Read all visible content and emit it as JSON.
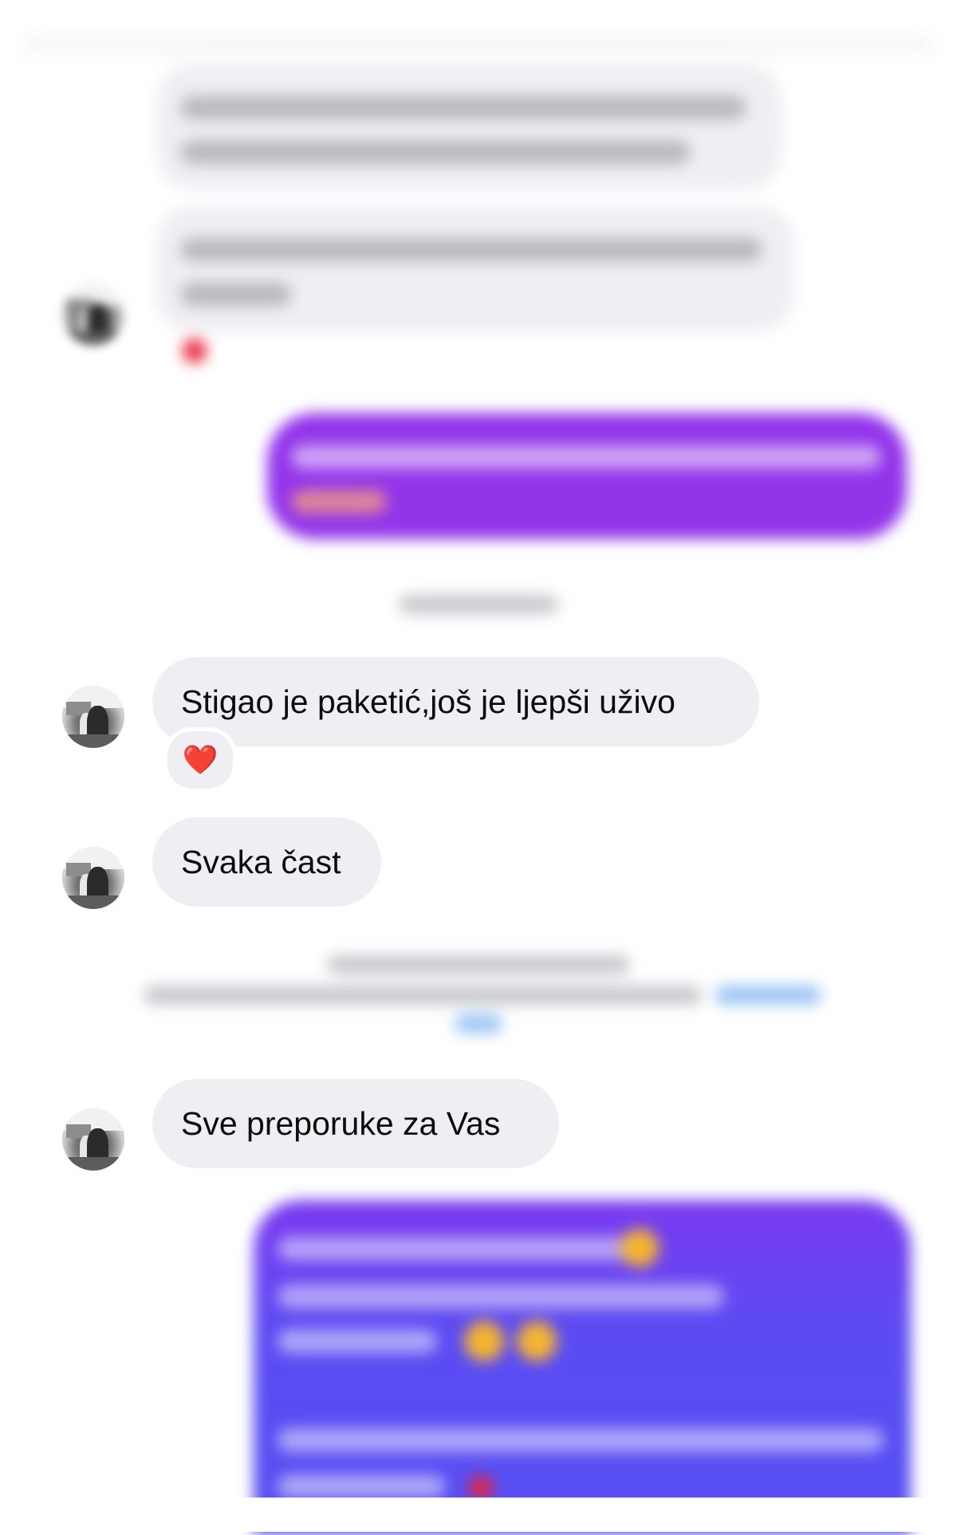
{
  "chat": {
    "messages": [
      {
        "id": "m1",
        "direction": "incoming",
        "text": "Stigao je paketić,još je ljepši uživo",
        "reaction": "❤️"
      },
      {
        "id": "m2",
        "direction": "incoming",
        "text": "Svaka čast"
      },
      {
        "id": "m3",
        "direction": "incoming",
        "text": "Sve preporuke za Vas"
      }
    ],
    "obscured_note": "Other messages, the timestamp and the system notice are blurred in the screenshot."
  },
  "colors": {
    "incoming_bubble": "#efeff3",
    "outgoing_purple": "#9234ea",
    "outgoing_blue": "#574ff2",
    "link_blue": "#2d8cf0",
    "heart_red": "#e3192f",
    "text": "#0b0b0b"
  },
  "icons": {
    "reaction": "heart-emoji",
    "avatar": "user-avatar-photo"
  }
}
